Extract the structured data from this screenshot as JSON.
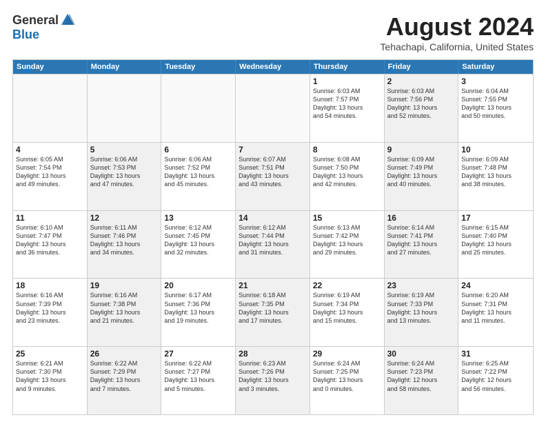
{
  "logo": {
    "general": "General",
    "blue": "Blue"
  },
  "title": "August 2024",
  "subtitle": "Tehachapi, California, United States",
  "header_days": [
    "Sunday",
    "Monday",
    "Tuesday",
    "Wednesday",
    "Thursday",
    "Friday",
    "Saturday"
  ],
  "rows": [
    [
      {
        "day": "",
        "detail": "",
        "empty": true
      },
      {
        "day": "",
        "detail": "",
        "empty": true
      },
      {
        "day": "",
        "detail": "",
        "empty": true
      },
      {
        "day": "",
        "detail": "",
        "empty": true
      },
      {
        "day": "1",
        "detail": "Sunrise: 6:03 AM\nSunset: 7:57 PM\nDaylight: 13 hours\nand 54 minutes."
      },
      {
        "day": "2",
        "detail": "Sunrise: 6:03 AM\nSunset: 7:56 PM\nDaylight: 13 hours\nand 52 minutes.",
        "shaded": true
      },
      {
        "day": "3",
        "detail": "Sunrise: 6:04 AM\nSunset: 7:55 PM\nDaylight: 13 hours\nand 50 minutes."
      }
    ],
    [
      {
        "day": "4",
        "detail": "Sunrise: 6:05 AM\nSunset: 7:54 PM\nDaylight: 13 hours\nand 49 minutes."
      },
      {
        "day": "5",
        "detail": "Sunrise: 6:06 AM\nSunset: 7:53 PM\nDaylight: 13 hours\nand 47 minutes.",
        "shaded": true
      },
      {
        "day": "6",
        "detail": "Sunrise: 6:06 AM\nSunset: 7:52 PM\nDaylight: 13 hours\nand 45 minutes."
      },
      {
        "day": "7",
        "detail": "Sunrise: 6:07 AM\nSunset: 7:51 PM\nDaylight: 13 hours\nand 43 minutes.",
        "shaded": true
      },
      {
        "day": "8",
        "detail": "Sunrise: 6:08 AM\nSunset: 7:50 PM\nDaylight: 13 hours\nand 42 minutes."
      },
      {
        "day": "9",
        "detail": "Sunrise: 6:09 AM\nSunset: 7:49 PM\nDaylight: 13 hours\nand 40 minutes.",
        "shaded": true
      },
      {
        "day": "10",
        "detail": "Sunrise: 6:09 AM\nSunset: 7:48 PM\nDaylight: 13 hours\nand 38 minutes."
      }
    ],
    [
      {
        "day": "11",
        "detail": "Sunrise: 6:10 AM\nSunset: 7:47 PM\nDaylight: 13 hours\nand 36 minutes."
      },
      {
        "day": "12",
        "detail": "Sunrise: 6:11 AM\nSunset: 7:46 PM\nDaylight: 13 hours\nand 34 minutes.",
        "shaded": true
      },
      {
        "day": "13",
        "detail": "Sunrise: 6:12 AM\nSunset: 7:45 PM\nDaylight: 13 hours\nand 32 minutes."
      },
      {
        "day": "14",
        "detail": "Sunrise: 6:12 AM\nSunset: 7:44 PM\nDaylight: 13 hours\nand 31 minutes.",
        "shaded": true
      },
      {
        "day": "15",
        "detail": "Sunrise: 6:13 AM\nSunset: 7:42 PM\nDaylight: 13 hours\nand 29 minutes."
      },
      {
        "day": "16",
        "detail": "Sunrise: 6:14 AM\nSunset: 7:41 PM\nDaylight: 13 hours\nand 27 minutes.",
        "shaded": true
      },
      {
        "day": "17",
        "detail": "Sunrise: 6:15 AM\nSunset: 7:40 PM\nDaylight: 13 hours\nand 25 minutes."
      }
    ],
    [
      {
        "day": "18",
        "detail": "Sunrise: 6:16 AM\nSunset: 7:39 PM\nDaylight: 13 hours\nand 23 minutes."
      },
      {
        "day": "19",
        "detail": "Sunrise: 6:16 AM\nSunset: 7:38 PM\nDaylight: 13 hours\nand 21 minutes.",
        "shaded": true
      },
      {
        "day": "20",
        "detail": "Sunrise: 6:17 AM\nSunset: 7:36 PM\nDaylight: 13 hours\nand 19 minutes."
      },
      {
        "day": "21",
        "detail": "Sunrise: 6:18 AM\nSunset: 7:35 PM\nDaylight: 13 hours\nand 17 minutes.",
        "shaded": true
      },
      {
        "day": "22",
        "detail": "Sunrise: 6:19 AM\nSunset: 7:34 PM\nDaylight: 13 hours\nand 15 minutes."
      },
      {
        "day": "23",
        "detail": "Sunrise: 6:19 AM\nSunset: 7:33 PM\nDaylight: 13 hours\nand 13 minutes.",
        "shaded": true
      },
      {
        "day": "24",
        "detail": "Sunrise: 6:20 AM\nSunset: 7:31 PM\nDaylight: 13 hours\nand 11 minutes."
      }
    ],
    [
      {
        "day": "25",
        "detail": "Sunrise: 6:21 AM\nSunset: 7:30 PM\nDaylight: 13 hours\nand 9 minutes."
      },
      {
        "day": "26",
        "detail": "Sunrise: 6:22 AM\nSunset: 7:29 PM\nDaylight: 13 hours\nand 7 minutes.",
        "shaded": true
      },
      {
        "day": "27",
        "detail": "Sunrise: 6:22 AM\nSunset: 7:27 PM\nDaylight: 13 hours\nand 5 minutes."
      },
      {
        "day": "28",
        "detail": "Sunrise: 6:23 AM\nSunset: 7:26 PM\nDaylight: 13 hours\nand 3 minutes.",
        "shaded": true
      },
      {
        "day": "29",
        "detail": "Sunrise: 6:24 AM\nSunset: 7:25 PM\nDaylight: 13 hours\nand 0 minutes."
      },
      {
        "day": "30",
        "detail": "Sunrise: 6:24 AM\nSunset: 7:23 PM\nDaylight: 12 hours\nand 58 minutes.",
        "shaded": true
      },
      {
        "day": "31",
        "detail": "Sunrise: 6:25 AM\nSunset: 7:22 PM\nDaylight: 12 hours\nand 56 minutes."
      }
    ]
  ]
}
